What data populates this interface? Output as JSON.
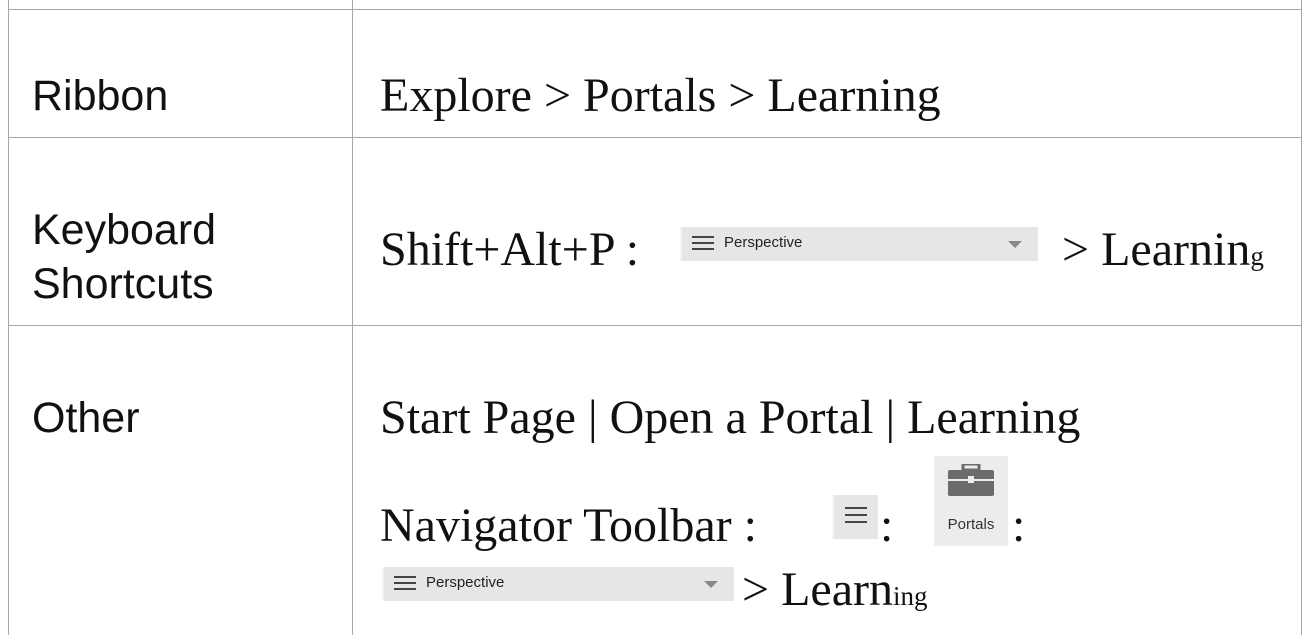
{
  "rows": [
    {
      "label_lines": [
        "Ribbon"
      ],
      "path": "Explore > Portals > Learning"
    },
    {
      "label_lines": [
        "Keyboard",
        "Shortcuts"
      ],
      "prefix": "Shift+Alt+P : ",
      "perspective_label": "Perspective",
      "suffix_main": " > Learnin",
      "suffix_tiny": "g"
    },
    {
      "label_lines": [
        "Other"
      ],
      "path": "Start Page | Open a Portal | Learning",
      "navigator_prefix": "Navigator Toolbar : ",
      "separator": " : ",
      "portals_label": "Portals",
      "perspective_label": "Perspective",
      "suffix_main": " > Learn",
      "suffix_tiny": "ing"
    }
  ],
  "icons": {
    "menu": "hamburger-menu-icon",
    "dropdown": "chevron-down-icon",
    "portals": "briefcase-icon"
  },
  "colors": {
    "grid": "#a6a6a6",
    "control_bg": "#e6e6e6",
    "text": "#111111"
  }
}
